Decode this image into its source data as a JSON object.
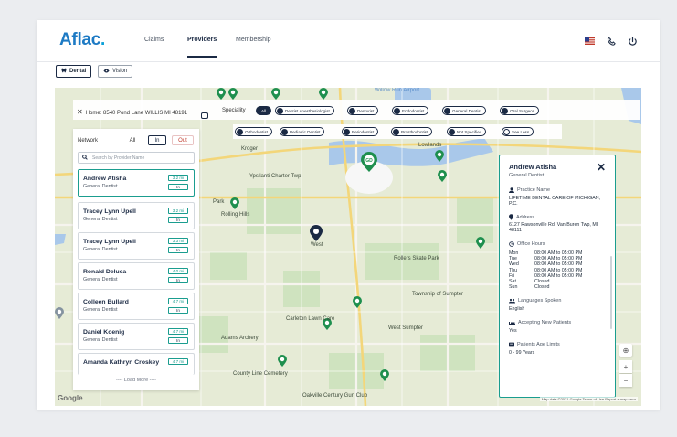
{
  "app": {
    "brand": "Aflac",
    "nav": [
      {
        "label": "Claims",
        "active": false
      },
      {
        "label": "Providers",
        "active": true
      },
      {
        "label": "Membership",
        "active": false
      }
    ],
    "icons": [
      "us-flag-icon",
      "phone-icon",
      "power-icon"
    ]
  },
  "toggles": [
    {
      "label": "Dental",
      "selected": true,
      "icon": "tooth-icon"
    },
    {
      "label": "Vision",
      "selected": false,
      "icon": "eye-icon"
    }
  ],
  "search_bar": {
    "home_address": "Home: 8540 Pond Lane WILLIS MI 48191",
    "speciality_label": "Speciality",
    "chips_row1": [
      "All",
      "Dentist Anesthesiologist",
      "Denturist",
      "Endodontist",
      "General Dentist",
      "Oral Surgeon"
    ],
    "chips_row2": [
      "Orthodontist",
      "Pediatric Dentist",
      "Periodontist",
      "Prosthodontist",
      "Not Specified",
      "See Less"
    ]
  },
  "network": {
    "label": "Network",
    "options": [
      "All",
      "In",
      "Out"
    ],
    "selected": "In",
    "search_placeholder": "Search by Provider Name"
  },
  "providers": [
    {
      "name": "Andrew Atisha",
      "specialty": "General Dentist",
      "distance": "3.2 mi",
      "network": "In",
      "selected": true
    },
    {
      "name": "Tracey Lynn Upell",
      "specialty": "General Dentist",
      "distance": "3.2 mi",
      "network": "In",
      "selected": false
    },
    {
      "name": "Tracey Lynn Upell",
      "specialty": "General Dentist",
      "distance": "3.3 mi",
      "network": "In",
      "selected": false
    },
    {
      "name": "Ronald Deluca",
      "specialty": "General Dentist",
      "distance": "4.0 mi",
      "network": "In",
      "selected": false
    },
    {
      "name": "Colleen Bullard",
      "specialty": "General Dentist",
      "distance": "4.7 mi",
      "network": "In",
      "selected": false
    },
    {
      "name": "Daniel Koenig",
      "specialty": "General Dentist",
      "distance": "4.7 mi",
      "network": "In",
      "selected": false
    },
    {
      "name": "Amanda Kathryn Croskey",
      "specialty": "",
      "distance": "4.7 mi",
      "network": "",
      "selected": false
    }
  ],
  "load_more": "---- Load More ----",
  "detail": {
    "name": "Andrew Atisha",
    "specialty": "General Dentist",
    "practice_label": "Practice Name",
    "practice": "LIFETIME DENTAL CARE OF MICHIGAN, P.C.",
    "address_label": "Address",
    "address": "6127 Rawsonville Rd, Van Buren Twp, MI 48111",
    "hours_label": "Office Hours",
    "hours": [
      {
        "day": "Mon",
        "time": "08:00 AM to 05:00 PM"
      },
      {
        "day": "Tue",
        "time": "08:00 AM to 05:00 PM"
      },
      {
        "day": "Wed",
        "time": "08:00 AM to 05:00 PM"
      },
      {
        "day": "Thu",
        "time": "08:00 AM to 05:00 PM"
      },
      {
        "day": "Fri",
        "time": "08:00 AM to 05:00 PM"
      },
      {
        "day": "Sat",
        "time": "Closed"
      },
      {
        "day": "Sun",
        "time": "Closed"
      }
    ],
    "languages_label": "Languages Spoken",
    "languages": "English",
    "accepting_label": "Accepting New Patients",
    "accepting": "Yes",
    "age_label": "Patients Age Limits",
    "age": "0 - 99 Years"
  },
  "map": {
    "labels": [
      "Ypsilanti Charter Twp",
      "Rollers Skate Park",
      "Township of Sumpter",
      "Carleton Lawn Care",
      "West Sumpter",
      "Adams Archery",
      "County Line Cemetery",
      "Oakville Century Gun Club",
      "Rolling Hills",
      "Lowlands",
      "Willow Run Airport",
      "Kroger",
      "West",
      "Park"
    ],
    "marker_label": "GD",
    "google": "Google",
    "attribution": "Map data ©2021 Google  Terms of Use  Report a map error"
  },
  "colors": {
    "accent": "#1a9d8f",
    "navy": "#1b2a44",
    "brand": "#1d7ac4",
    "marker": "#1e8f4e"
  }
}
